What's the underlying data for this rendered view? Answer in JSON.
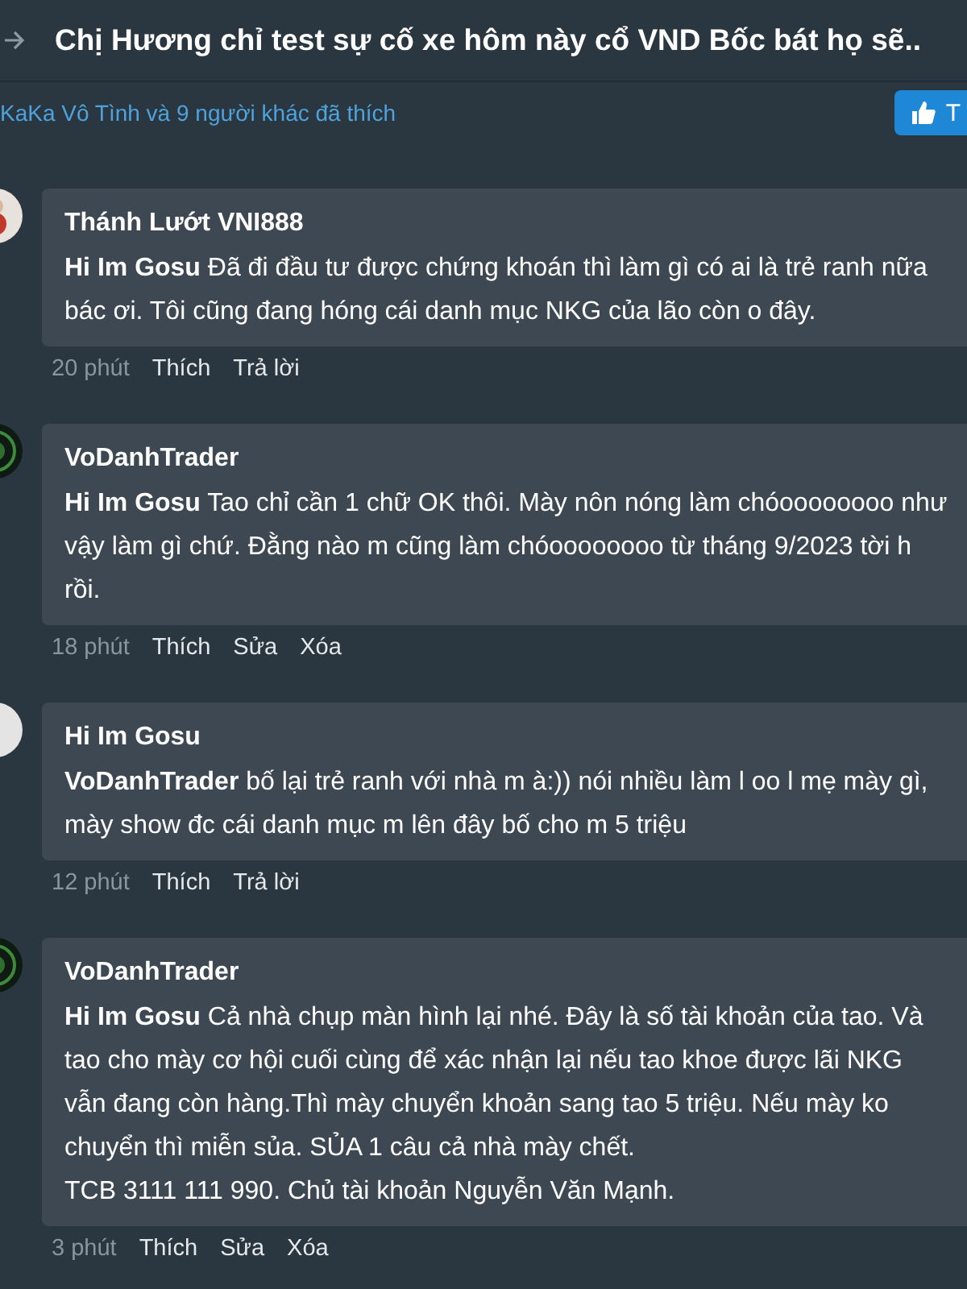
{
  "header": {
    "title": "Chị Hương chỉ test sự cố xe hôm này cổ VND Bốc bát họ sẽ.."
  },
  "likes": {
    "text": "KaKa Vô Tình và 9 người khác đã thích",
    "button": "T"
  },
  "comments": [
    {
      "author": "Thánh Lướt VNI888",
      "kind": "photo",
      "mention": "Hi Im Gosu",
      "body": "Đã đi đầu tư được chứng khoán thì làm gì có ai là trẻ ranh nữa bác ơi. Tôi cũng đang hóng cái danh mục NKG của lão còn o đây.",
      "time": "20 phút",
      "actions": [
        "Thích",
        "Trả lời"
      ]
    },
    {
      "author": "VoDanhTrader",
      "kind": "emblem",
      "mention": "Hi Im Gosu",
      "body": "Tao chỉ cần 1 chữ OK thôi. Mày nôn nóng làm chóoooooooo như vậy làm gì chứ. Đằng nào m cũng làm chóoooooooo từ tháng 9/2023 tời h rồi.",
      "time": "18 phút",
      "actions": [
        "Thích",
        "Sửa",
        "Xóa"
      ]
    },
    {
      "author": "Hi Im Gosu",
      "kind": "default",
      "mention": "VoDanhTrader",
      "body": "bố lại trẻ ranh với nhà m à:)) nói nhiều làm l oo l mẹ mày gì, mày show đc cái danh mục m lên đây bố cho m 5 triệu",
      "time": "12 phút",
      "actions": [
        "Thích",
        "Trả lời"
      ]
    },
    {
      "author": "VoDanhTrader",
      "kind": "emblem",
      "mention": "Hi Im Gosu",
      "body": "Cả nhà chụp màn hình lại nhé. Đây là số tài khoản của tao. Và tao cho mày cơ hội cuối cùng để xác nhận lại nếu tao khoe được lãi NKG vẫn đang còn hàng.Thì mày chuyển khoản sang tao 5 triệu. Nếu mày ko chuyển thì miễn sủa. SỦA 1 câu cả nhà mày chết.\nTCB 3111 111 990. Chủ tài khoản Nguyễn Văn Mạnh.",
      "time": "3 phút",
      "actions": [
        "Thích",
        "Sửa",
        "Xóa"
      ]
    }
  ]
}
